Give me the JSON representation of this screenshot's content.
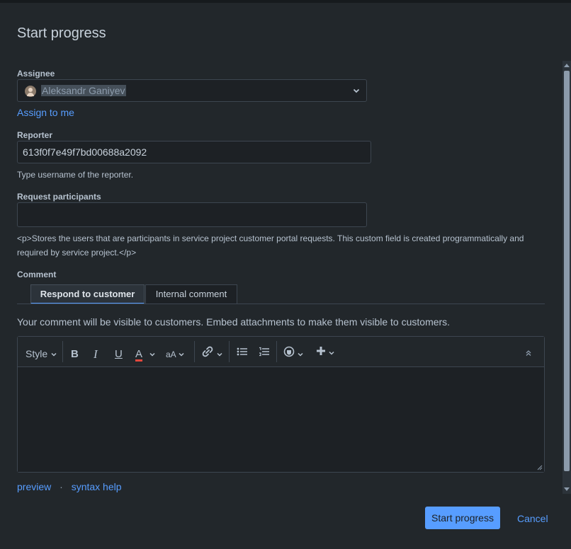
{
  "dialog": {
    "title": "Start progress"
  },
  "assignee": {
    "label": "Assignee",
    "value": "Aleksandr Ganiyev",
    "assign_to_me": "Assign to me"
  },
  "reporter": {
    "label": "Reporter",
    "value": "613f0f7e49f7bd00688a2092",
    "help": "Type username of the reporter."
  },
  "participants": {
    "label": "Request participants",
    "value": "",
    "help_line1": "<p>Stores the users that are participants in service project customer portal requests. This custom field is created programmatically and",
    "help_line2": "required by service project.</p>"
  },
  "comment": {
    "label": "Comment",
    "tabs": [
      {
        "label": "Respond to customer",
        "active": true
      },
      {
        "label": "Internal comment",
        "active": false
      }
    ],
    "notice": "Your comment will be visible to customers. Embed attachments to make them visible to customers.",
    "toolbar": {
      "style_label": "Style",
      "bold": "B",
      "italic": "I",
      "underline": "U",
      "text_color": "A",
      "text_size": "aA"
    },
    "body": "",
    "preview": "preview",
    "separator": "·",
    "syntax_help": "syntax help"
  },
  "footer": {
    "submit": "Start progress",
    "cancel": "Cancel"
  },
  "colors": {
    "accent": "#579dff",
    "primary_button": "#579dff",
    "text_color_underline": "#e2483d"
  }
}
